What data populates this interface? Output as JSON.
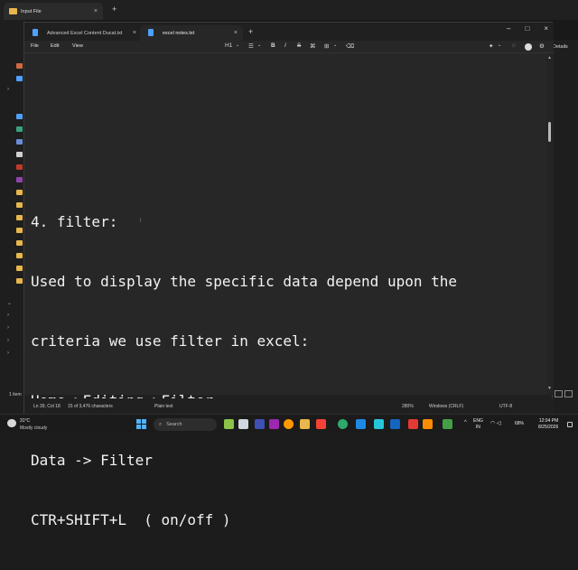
{
  "explorer": {
    "tab_title": "Input File",
    "new_tab": "+",
    "close": "×",
    "details_label": "Details",
    "status_text": "1 item"
  },
  "notepad": {
    "tabs": [
      {
        "label": "Advanced Excel Content Ducat.txt",
        "close": "×"
      },
      {
        "label": "excel notes.txt",
        "close": "×"
      }
    ],
    "new_tab": "+",
    "window_controls": {
      "minimize": "–",
      "maximize": "□",
      "close": "×"
    },
    "menu": {
      "file": "File",
      "edit": "Edit",
      "view": "View"
    },
    "toolbar": {
      "heading": "H1",
      "heading_caret": "⌄",
      "list": "☰",
      "list_caret": "⌄",
      "bold": "B",
      "italic": "I",
      "strikethrough": "S",
      "link": "⌘",
      "table": "⊞",
      "table_caret": "⌄",
      "clear": "⌫",
      "copilot": "✦",
      "copilot_caret": "⌄",
      "editor_settings": "⚙"
    },
    "content_lines": [
      "4. filter:",
      "Used to display the specific data depend upon the",
      "criteria we use filter in excel:",
      "Home->Editing->Filter",
      "Data -> Filter",
      "CTR+SHIFT+L  ( on/off )"
    ],
    "status": {
      "position": "Ln 39, Col 18",
      "chars": "15 of 3,476 characters",
      "format": "Plain text",
      "zoom": "280%",
      "line_ending": "Windows (CRLF)",
      "encoding": "UTF-8"
    }
  },
  "taskbar": {
    "temperature": "31°C",
    "weather": "Mostly cloudy",
    "search_placeholder": "Search",
    "lang_line1": "ENG",
    "lang_line2": "IN",
    "battery": "68%",
    "time": "12:04 PM",
    "date": "8/25/2026"
  },
  "colors": {
    "accent": "#4fb3ff",
    "folder": "#e8b64c",
    "editor_bg": "#272727",
    "text": "#f2f2f2"
  }
}
